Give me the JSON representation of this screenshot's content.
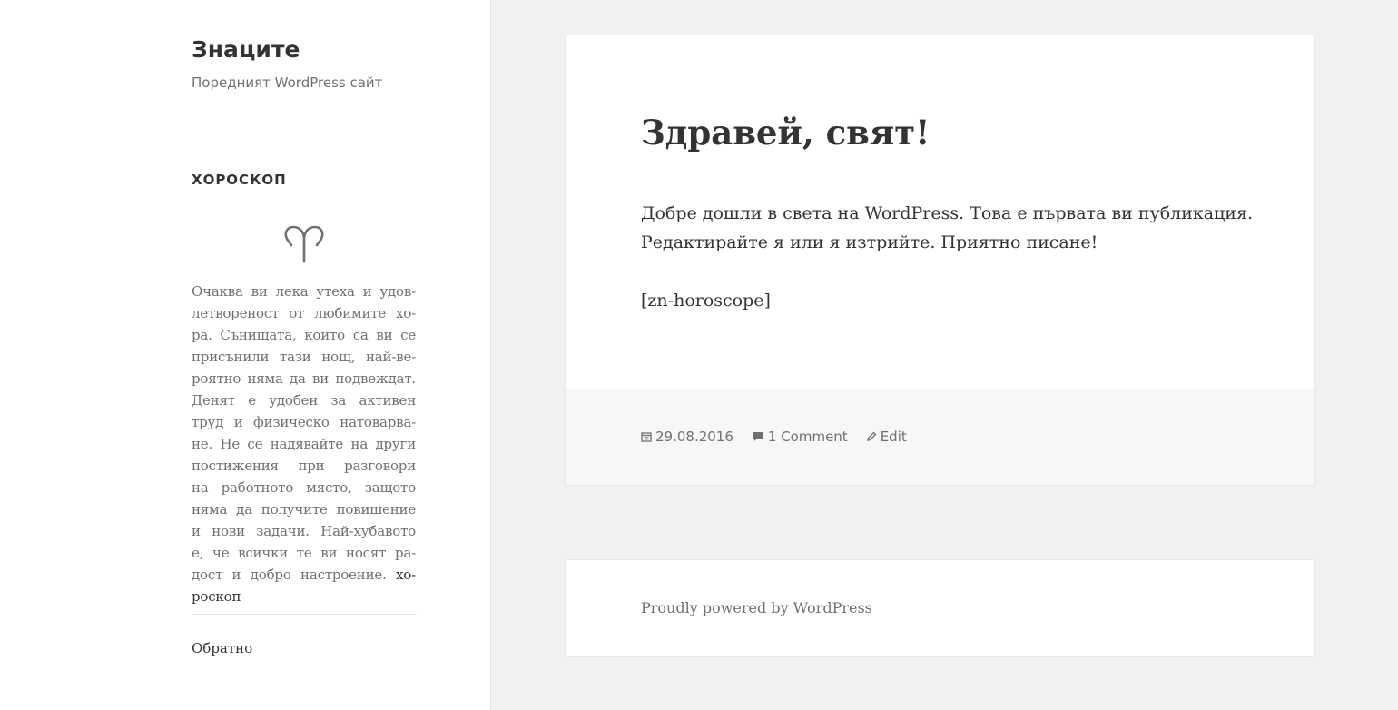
{
  "site": {
    "title": "Знаците",
    "description": "Поредният WordPress сайт"
  },
  "widget": {
    "title": "ХОРОСКОП",
    "zodiac_icon": "aries-icon",
    "lines": [
      "Очаква ви лека утеха и удов-",
      "летвореност от любимите хо-",
      "ра. Сънищата, които са ви се",
      "присънили тази нощ, най-ве-",
      "роятно няма да ви подвеждат.",
      "Денят е удобен за активен",
      "труд и физическо натоварва-",
      "не. Не се надявайте на други",
      "постижения при разговори",
      "на работното място, защото",
      "няма да получите повишение",
      "и нови задачи. Най-хубавото",
      "е, че всички те ви носят ра-",
      "дост и добро настроение."
    ],
    "link_part1": "хо-",
    "link_part2": "роскоп",
    "back_link": "Обратно"
  },
  "post": {
    "title": "Здравей, свят!",
    "paragraph1": "Добре дошли в света на WordPress. Това е първата ви публикация. Редактирайте я или я изтрийте. Приятно писане!",
    "paragraph2": "[zn-horoscope]",
    "date": "29.08.2016",
    "comments": "1 Comment",
    "edit": "Edit"
  },
  "footer": {
    "powered": "Proudly powered by WordPress"
  },
  "colors": {
    "background": "#f1f1f1",
    "card": "#ffffff",
    "meta_bg": "#f7f7f7",
    "text": "#333333",
    "muted": "#707070"
  }
}
